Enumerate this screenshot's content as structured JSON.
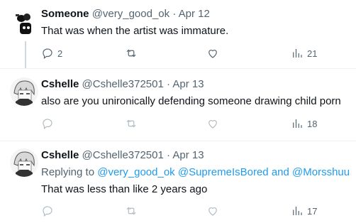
{
  "tweets": [
    {
      "name": "Someone",
      "handle": "@very_good_ok",
      "separator": "·",
      "date": "Apr 12",
      "text": "That was when the artist was immature.",
      "replies": "2",
      "views": "21"
    },
    {
      "name": "Cshelle",
      "handle": "@Cshelle372501",
      "separator": "·",
      "date": "Apr 13",
      "text": "also are you unironically defending someone drawing child porn",
      "views": "18"
    },
    {
      "name": "Cshelle",
      "handle": "@Cshelle372501",
      "separator": "·",
      "date": "Apr 13",
      "replying_prefix": "Replying to ",
      "mention_1": "@very_good_ok",
      "mention_2": "@SupremeIsBored",
      "and_word": " and ",
      "mention_3": "@Morsshuu",
      "text": "That was less than like 2 years ago",
      "views": "17"
    }
  ],
  "colors": {
    "accent": "#1d9bf0",
    "muted": "#536471",
    "text": "#0f1419",
    "divider": "#eff3f4"
  }
}
